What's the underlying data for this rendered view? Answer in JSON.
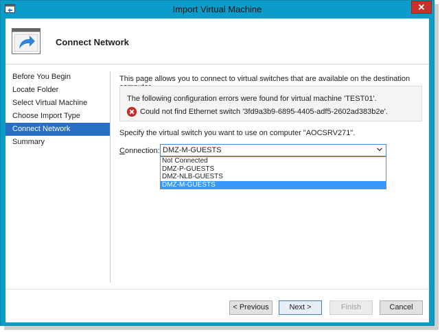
{
  "window": {
    "title": "Import Virtual Machine",
    "close_glyph": "✕"
  },
  "header": {
    "title": "Connect Network",
    "icon": "arrow-window-icon"
  },
  "nav": {
    "items": [
      {
        "label": "Before You Begin",
        "active": false
      },
      {
        "label": "Locate Folder",
        "active": false
      },
      {
        "label": "Select Virtual Machine",
        "active": false
      },
      {
        "label": "Choose Import Type",
        "active": false
      },
      {
        "label": "Connect Network",
        "active": true
      },
      {
        "label": "Summary",
        "active": false
      }
    ]
  },
  "main": {
    "intro": "This page allows you to connect to virtual switches that are available on the destination computer.",
    "error_box": {
      "title": "The following configuration errors were found for virtual machine 'TEST01'.",
      "message": "Could not find Ethernet switch '3fd9a3b9-6895-4405-adf5-2602ad383b2e'."
    },
    "specify": "Specify the virtual switch you want to use on computer \"AOCSRV271\".",
    "connection": {
      "label_prefix": "C",
      "label_rest": "onnection:",
      "value": "DMZ-M-GUESTS",
      "options": [
        "Not Connected",
        "DMZ-P-GUESTS",
        "DMZ-NLB-GUESTS",
        "DMZ-M-GUESTS"
      ],
      "selected_index": 3
    }
  },
  "buttons": {
    "previous": "< Previous",
    "next": "Next >",
    "finish": "Finish",
    "cancel": "Cancel"
  },
  "colors": {
    "titlebar": "#0b9cc9",
    "nav_active": "#2a6fc6",
    "option_selected": "#3399ff",
    "close": "#c7312b"
  }
}
